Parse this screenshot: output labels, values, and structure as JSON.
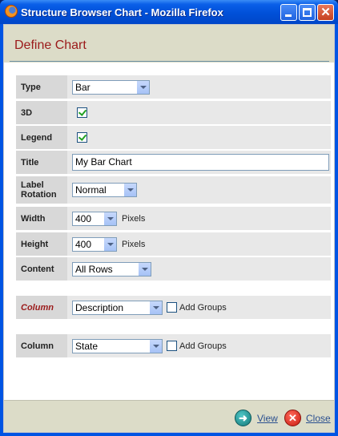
{
  "window": {
    "title": "Structure Browser Chart - Mozilla Firefox"
  },
  "header": {
    "title": "Define Chart"
  },
  "form": {
    "type": {
      "label": "Type",
      "value": "Bar"
    },
    "three_d": {
      "label": "3D",
      "checked": true
    },
    "legend": {
      "label": "Legend",
      "checked": true
    },
    "title": {
      "label": "Title",
      "value": "My Bar Chart"
    },
    "label_rotation": {
      "label_line1": "Label",
      "label_line2": "Rotation",
      "value": "Normal"
    },
    "width": {
      "label": "Width",
      "value": "400",
      "unit": "Pixels"
    },
    "height": {
      "label": "Height",
      "value": "400",
      "unit": "Pixels"
    },
    "content": {
      "label": "Content",
      "value": "All Rows"
    },
    "column1": {
      "label": "Column",
      "value": "Description",
      "add_groups_label": "Add Groups",
      "add_groups_checked": false
    },
    "column2": {
      "label": "Column",
      "value": "State",
      "add_groups_label": "Add Groups",
      "add_groups_checked": false
    }
  },
  "footer": {
    "view_label": "View",
    "close_label": "Close"
  },
  "icons": {
    "browser": "firefox-icon",
    "minimize": "minimize-icon",
    "maximize": "maximize-icon",
    "close_window": "close-window-icon",
    "view": "view-arrow-icon",
    "close": "close-x-icon"
  },
  "colors": {
    "accent": "#9b1a1a",
    "titlebar": "#0054e3",
    "header_bg": "#dcdcc8",
    "label_bg": "#d8d8d8",
    "value_bg": "#e8e8e8",
    "link": "#2a4f8f"
  }
}
